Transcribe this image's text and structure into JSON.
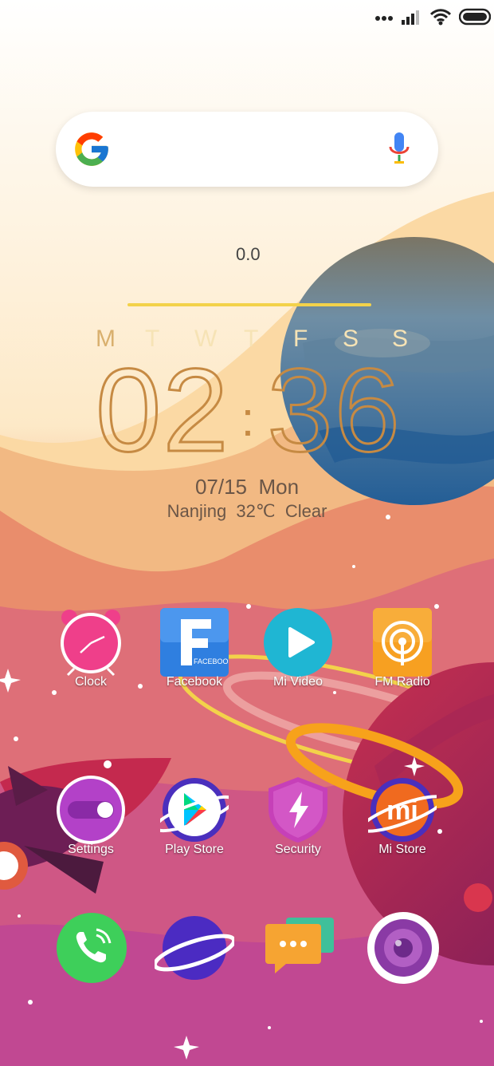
{
  "status_bar": {
    "icons": [
      "signal-dots-icon",
      "cellular-signal-icon",
      "wifi-icon",
      "battery-icon"
    ]
  },
  "search_bar": {
    "icons": [
      "google-g-icon",
      "microphone-icon"
    ]
  },
  "clock_widget": {
    "top_text": "0.0",
    "weekdays": [
      "M",
      "T",
      "W",
      "T",
      "F",
      "S",
      "S"
    ],
    "time_hours": "02",
    "time_separator": ":",
    "time_minutes": "36",
    "date": "07/15  Mon",
    "weather": "Nanjing  32℃  Clear"
  },
  "home_apps": [
    {
      "label": "Clock",
      "icon": "alarm-clock-icon"
    },
    {
      "label": "Facebook",
      "icon": "facebook-icon"
    },
    {
      "label": "Mi Video",
      "icon": "play-icon"
    },
    {
      "label": "FM Radio",
      "icon": "radio-icon"
    },
    {
      "label": "Settings",
      "icon": "toggle-settings-icon"
    },
    {
      "label": "Play Store",
      "icon": "play-store-icon"
    },
    {
      "label": "Security",
      "icon": "shield-bolt-icon"
    },
    {
      "label": "Mi Store",
      "icon": "mi-logo-icon"
    }
  ],
  "dock_apps": [
    {
      "icon": "phone-icon"
    },
    {
      "icon": "planet-browser-icon"
    },
    {
      "icon": "messaging-icon"
    },
    {
      "icon": "camera-icon"
    }
  ],
  "facebook_small_text": "FACEBOOK",
  "mi_logo_text": "mi",
  "colors": {
    "widget_gold": "#c68a43",
    "widget_bar": "#f3d24a",
    "label_text": "#ffffff"
  }
}
